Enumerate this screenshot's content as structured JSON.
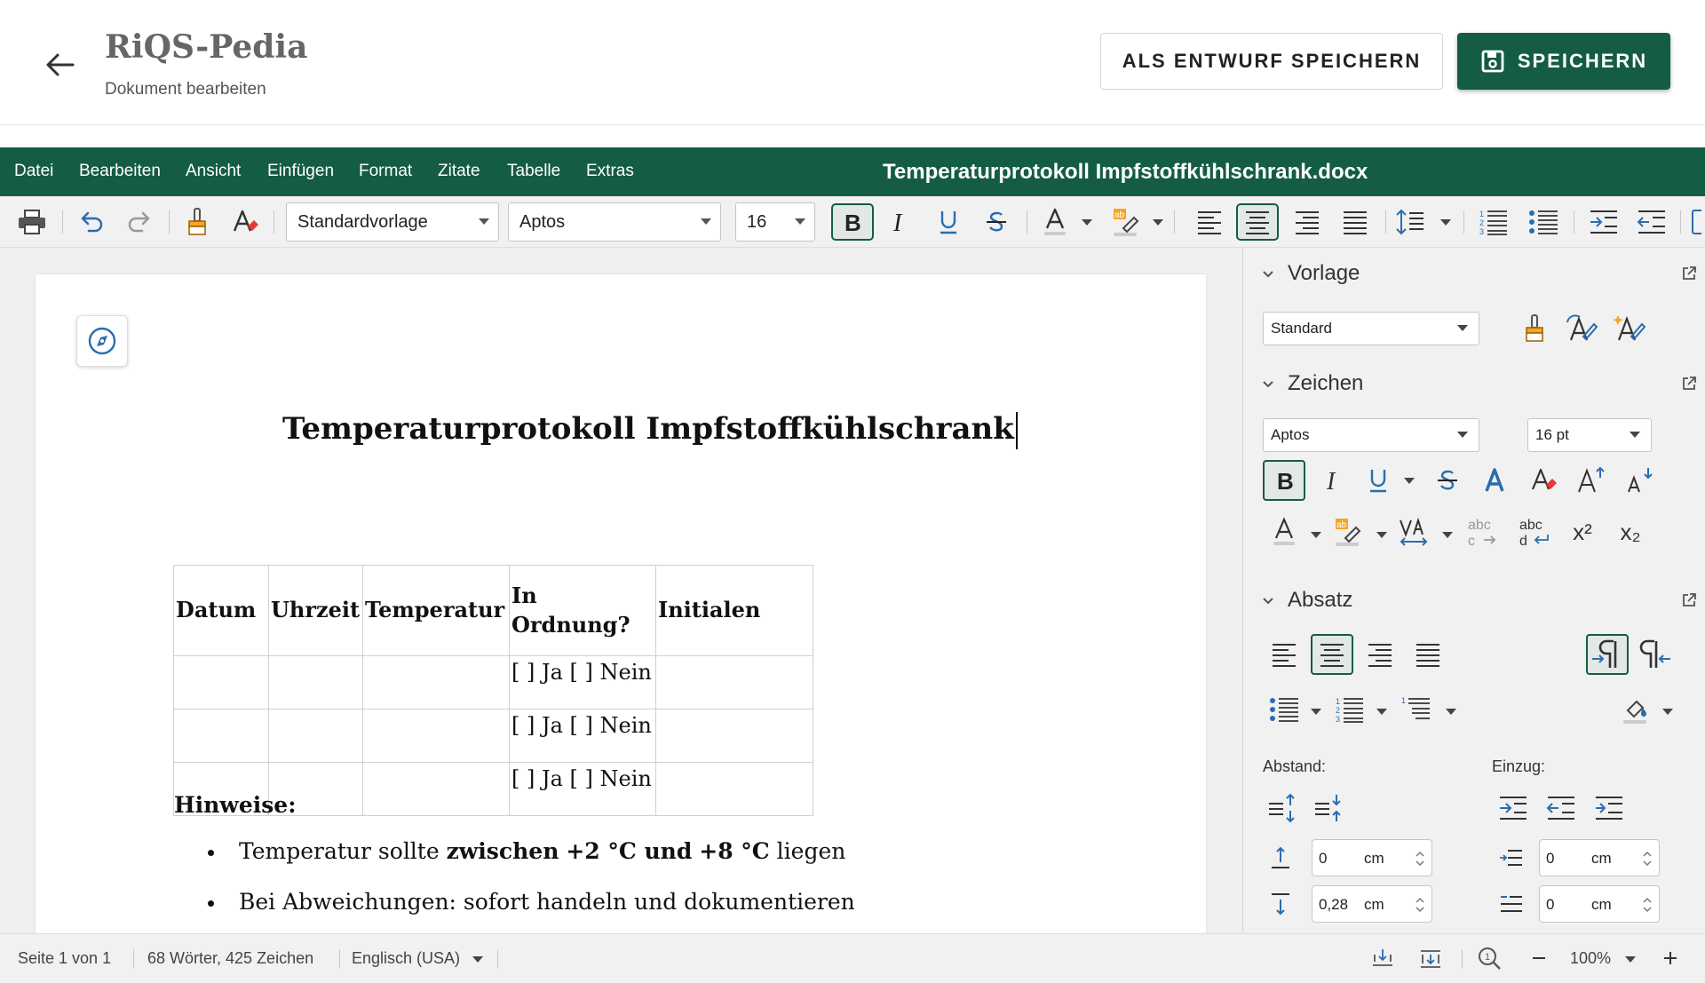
{
  "app": {
    "name": "RiQS-Pedia",
    "subtitle": "Dokument bearbeiten"
  },
  "header": {
    "draft_label": "ALS ENTWURF SPEICHERN",
    "save_label": "SPEICHERN"
  },
  "menu": {
    "items": [
      "Datei",
      "Bearbeiten",
      "Ansicht",
      "Einfügen",
      "Format",
      "Zitate",
      "Tabelle",
      "Extras"
    ],
    "document_title": "Temperaturprotokoll Impfstoffkühlschrank.docx"
  },
  "toolbar": {
    "style_value": "Standardvorlage",
    "font_value": "Aptos",
    "size_value": "16",
    "active_buttons": [
      "bold",
      "align-center"
    ]
  },
  "document": {
    "title": "Temperaturprotokoll Impfstoffkühlschrank",
    "table": {
      "headers": [
        "Datum",
        "Uhrzeit",
        "Temperatur",
        "In Ordnung?",
        "Initialen"
      ],
      "rows": [
        [
          "",
          "",
          "",
          "[ ] Ja [ ] Nein",
          ""
        ],
        [
          "",
          "",
          "",
          "[ ] Ja [ ] Nein",
          ""
        ],
        [
          "",
          "",
          "",
          "[ ] Ja [ ] Nein",
          ""
        ]
      ]
    },
    "notes_heading": "Hinweise:",
    "bullet1": {
      "p1": "Temperatur sollte ",
      "b1": "zwischen",
      "p2": " ",
      "b2": "+2 °C und",
      "p3": " ",
      "b3": "+8 °C",
      "p4": " liegen"
    },
    "bullet2": "Bei Abweichungen: sofort handeln und dokumentieren"
  },
  "sidebar": {
    "vorlage": {
      "title": "Vorlage",
      "style_value": "Standard"
    },
    "zeichen": {
      "title": "Zeichen",
      "font_value": "Aptos",
      "size_value": "16 pt",
      "superscript": "x²",
      "subscript": "x₂"
    },
    "absatz": {
      "title": "Absatz",
      "spacing_label": "Abstand:",
      "indent_label": "Einzug:",
      "spacing_before": "0",
      "spacing_after": "0,28",
      "indent_left": "0",
      "indent_first": "0",
      "unit": "cm"
    }
  },
  "status": {
    "page": "Seite 1 von 1",
    "words": "68 Wörter, 425 Zeichen",
    "language": "Englisch (USA)",
    "zoom": "100%"
  },
  "colors": {
    "accent": "#145c44",
    "toolbar_bg": "#f1f1f1",
    "icon_blue": "#2b6cb0"
  }
}
